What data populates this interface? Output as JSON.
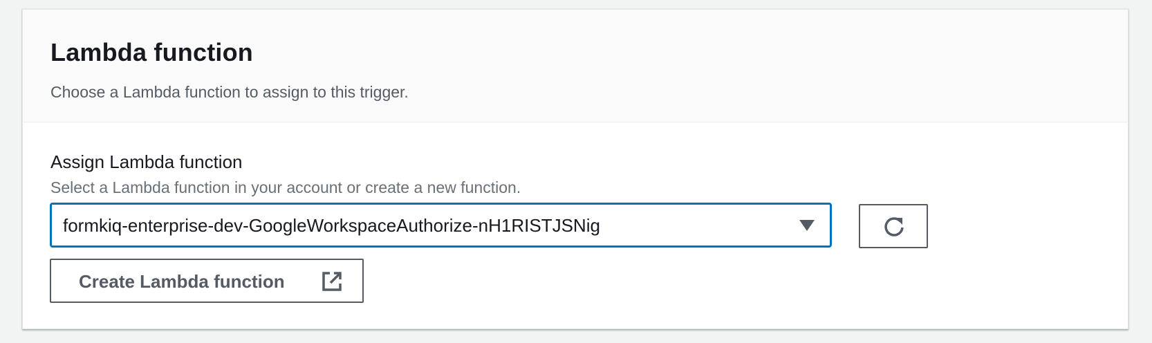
{
  "panel": {
    "title": "Lambda function",
    "description": "Choose a Lambda function to assign to this trigger."
  },
  "field": {
    "label": "Assign Lambda function",
    "description": "Select a Lambda function in your account or create a new function.",
    "selected_value": "formkiq-enterprise-dev-GoogleWorkspaceAuthorize-nH1RISTJSNig"
  },
  "buttons": {
    "create_label": "Create Lambda function",
    "refresh_icon": "refresh-icon",
    "external_icon": "external-link-icon"
  },
  "colors": {
    "accent": "#0073bb",
    "text": "#16191f",
    "muted": "#545b64"
  }
}
